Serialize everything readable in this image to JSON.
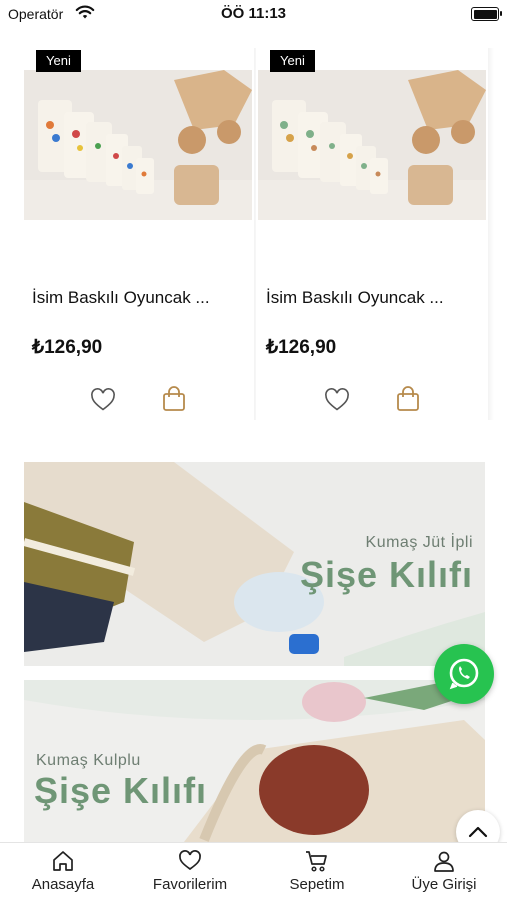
{
  "status_bar": {
    "carrier": "Operatör",
    "time": "ÖÖ 11:13"
  },
  "products": [
    {
      "badge": "Yeni",
      "title": "İsim Baskılı Oyuncak ...",
      "price": "₺126,90"
    },
    {
      "badge": "Yeni",
      "title": "İsim Baskılı Oyuncak ...",
      "price": "₺126,90"
    }
  ],
  "banners": [
    {
      "subtitle": "Kumaş Jüt İpli",
      "title": "Şişe Kılıfı"
    },
    {
      "subtitle": "Kumaş Kulplu",
      "title": "Şişe Kılıfı"
    }
  ],
  "bottom_nav": [
    {
      "label": "Anasayfa",
      "icon": "home-icon"
    },
    {
      "label": "Favorilerim",
      "icon": "heart-icon"
    },
    {
      "label": "Sepetim",
      "icon": "cart-icon"
    },
    {
      "label": "Üye Girişi",
      "icon": "user-icon"
    }
  ],
  "colors": {
    "accent": "#b68a4c",
    "whatsapp": "#27c350",
    "banner_text": "#6f9676"
  }
}
